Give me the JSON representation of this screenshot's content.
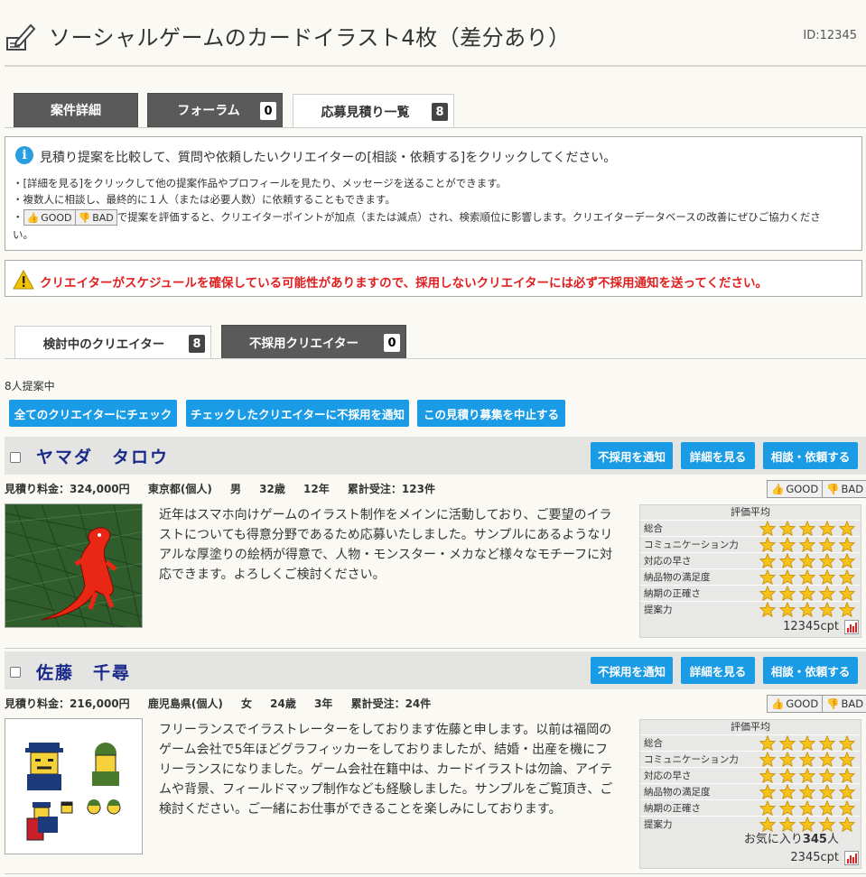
{
  "header": {
    "title": "ソーシャルゲームのカードイラスト4枚（差分あり）",
    "id": "ID:12345"
  },
  "tabs": [
    {
      "label": "案件詳細",
      "count": ""
    },
    {
      "label": "フォーラム",
      "count": "0"
    },
    {
      "label": "応募見積り一覧",
      "count": "8"
    }
  ],
  "info": {
    "main": "見積り提案を比較して、質問や依頼したいクリエイターの[相談・依頼する]をクリックしてください。",
    "line1": "・[詳細を見る]をクリックして他の提案作品やプロフィールを見たり、メッセージを送ることができます。",
    "line2": "・複数人に相談し、最終的に１人（または必要人数）に依頼することもできます。",
    "line3_pre": "・",
    "line3_post": "で提案を評価すると、クリエイターポイントが加点（または減点）され、検索順位に影響します。クリエイターデータベースの改善にぜひご協力くださ",
    "line4": "い。"
  },
  "warning": "クリエイターがスケジュールを確保している可能性がありますので、採用しないクリエイターには必ず不採用通知を送ってください。",
  "subtabs": [
    {
      "label": "検討中のクリエイター",
      "count": "8"
    },
    {
      "label": "不採用クリエイター",
      "count": "0"
    }
  ],
  "proposing": "8人提案中",
  "actions": {
    "check_all": "全てのクリエイターにチェック",
    "notify_checked": "チェックしたクリエイターに不採用を通知",
    "stop": "この見積り募集を中止する"
  },
  "good_label": "GOOD",
  "bad_label": "BAD",
  "rating": {
    "title": "評価平均",
    "labels": [
      "総合",
      "コミュニケーション力",
      "対応の早さ",
      "納品物の満足度",
      "納期の正確さ",
      "提案力"
    ]
  },
  "card_buttons": {
    "reject": "不採用を通知",
    "details": "詳細を見る",
    "consult": "相談・依頼する"
  },
  "creators": [
    {
      "name": "ヤマダ　タロウ",
      "stats": "見積り料金：324,000円　 東京都(個人)　 男　 32歳　 12年　 累計受注：123件",
      "description": "近年はスマホ向けゲームのイラスト制作をメインに活動しており、ご要望のイラストについても得意分野であるため応募いたしました。サンプルにあるようなリアルな厚塗りの絵柄が得意で、人物・モンスター・メカなど様々なモチーフに対応できます。よろしくご検討ください。",
      "stars": [
        5,
        5,
        5,
        5,
        5,
        5
      ],
      "points": "12345cpt",
      "favorites": ""
    },
    {
      "name": "佐藤　千尋",
      "stats": "見積り料金：216,000円　 鹿児島県(個人)　 女　 24歳　 3年　 累計受注：24件",
      "description": "フリーランスでイラストレーターをしております佐藤と申します。以前は福岡のゲーム会社で5年ほどグラフィッカーをしておりましたが、結婚・出産を機にフリーランスになりました。ゲーム会社在籍中は、カードイラストは勿論、アイテムや背景、フィールドマップ制作なども経験しました。サンプルをご覧頂き、ご検討ください。ご一緒にお仕事ができることを楽しみにしております。",
      "stars": [
        5,
        5,
        5,
        5,
        5,
        5
      ],
      "points": "2345cpt",
      "favorites_pre": "お気に入り",
      "favorites_num": "345",
      "favorites_post": "人"
    }
  ],
  "colors": {
    "accent_blue": "#1a9be5",
    "warning_red": "#e02020",
    "name_blue": "#1a2a8a",
    "dark_tab": "#5a5a5a"
  }
}
